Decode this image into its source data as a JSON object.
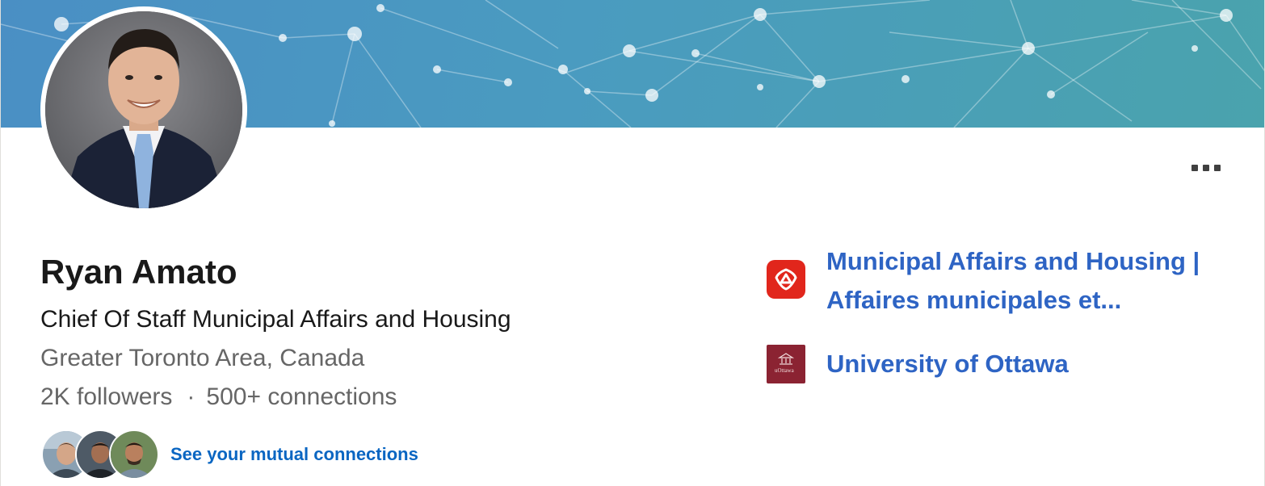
{
  "profile": {
    "name": "Ryan Amato",
    "headline": "Chief Of Staff Municipal Affairs and Housing",
    "location": "Greater Toronto Area, Canada",
    "followers": "2K followers",
    "separator": "·",
    "connections": "500+ connections"
  },
  "mutual": {
    "link_label": "See your mutual connections"
  },
  "experience": [
    {
      "line1": "Municipal Affairs and Housing |",
      "line2": "Affaires municipales et...",
      "logo_icon": "ontario-trillium-logo",
      "logo_color": "#e1261c"
    },
    {
      "line1": "University of Ottawa",
      "logo_icon": "uottawa-logo",
      "logo_text": "uOttawa",
      "logo_color": "#8b2332"
    }
  ],
  "actions": {
    "more_icon": "more-horizontal-icon"
  },
  "colors": {
    "link": "#0a66c2",
    "experience_link": "#2e64c4",
    "banner_start": "#4a8fc4",
    "banner_end": "#4aa3ad"
  }
}
